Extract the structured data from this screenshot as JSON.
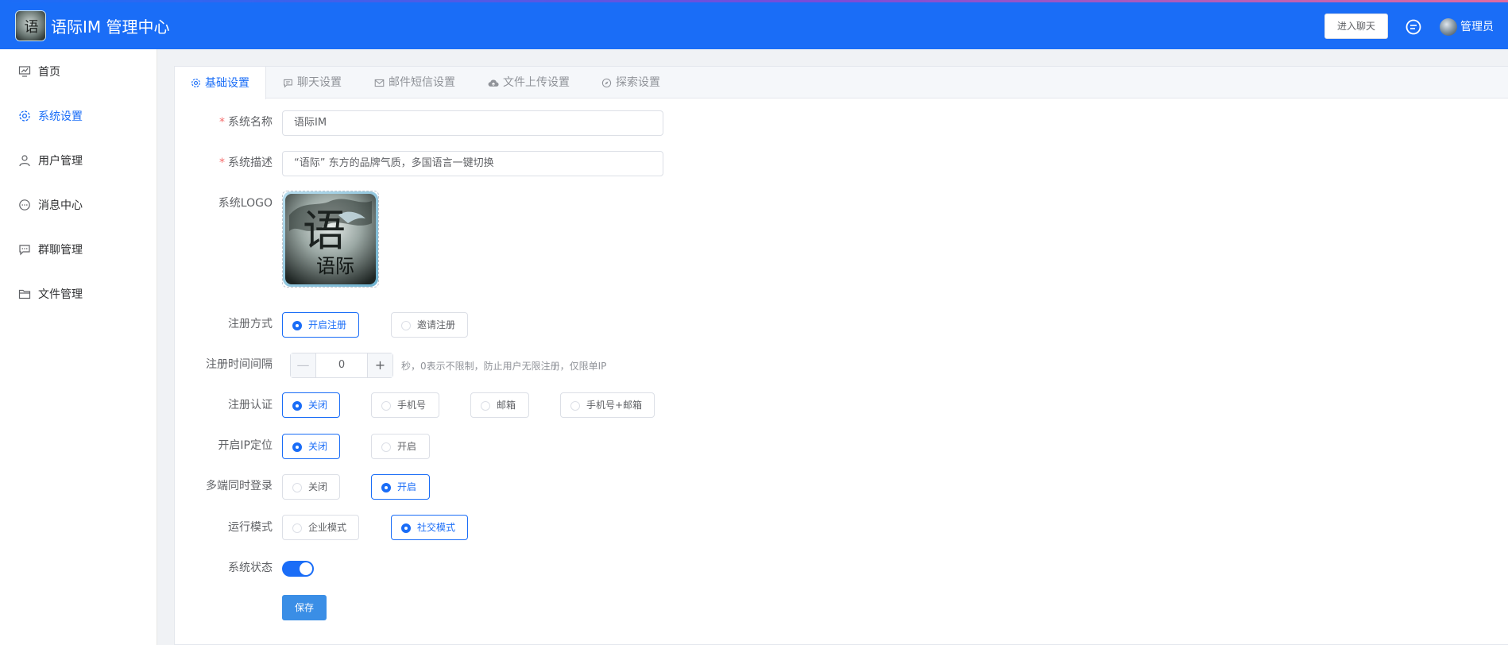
{
  "header": {
    "app_title": "语际IM 管理中心",
    "enter_chat_label": "进入聊天",
    "admin_name": "管理员",
    "brand_color": "#1a6df7"
  },
  "sidebar": {
    "items": [
      {
        "label": "首页",
        "icon": "home-chart-icon",
        "active": false
      },
      {
        "label": "系统设置",
        "icon": "gear-icon",
        "active": true
      },
      {
        "label": "用户管理",
        "icon": "user-icon",
        "active": false
      },
      {
        "label": "消息中心",
        "icon": "message-icon",
        "active": false
      },
      {
        "label": "群聊管理",
        "icon": "group-chat-icon",
        "active": false
      },
      {
        "label": "文件管理",
        "icon": "folder-icon",
        "active": false
      }
    ]
  },
  "tabs": [
    {
      "label": "基础设置",
      "icon": "gear-icon",
      "active": true
    },
    {
      "label": "聊天设置",
      "icon": "chat-icon",
      "active": false
    },
    {
      "label": "邮件短信设置",
      "icon": "mail-icon",
      "active": false
    },
    {
      "label": "文件上传设置",
      "icon": "cloud-upload-icon",
      "active": false
    },
    {
      "label": "探索设置",
      "icon": "compass-icon",
      "active": false
    }
  ],
  "form": {
    "system_name": {
      "label": "系统名称",
      "value": "语际IM",
      "required": true
    },
    "system_desc": {
      "label": "系统描述",
      "value": "“语际” 东方的品牌气质，多国语言一键切换",
      "required": true
    },
    "system_logo": {
      "label": "系统LOGO",
      "logo_text_top": "语",
      "logo_text_bottom": "语际"
    },
    "register_mode": {
      "label": "注册方式",
      "options": [
        "开启注册",
        "邀请注册"
      ],
      "selected": "开启注册"
    },
    "register_interval": {
      "label": "注册时间间隔",
      "value": "0",
      "minus": "—",
      "plus": "+",
      "hint": "秒，0表示不限制，防止用户无限注册，仅限单IP"
    },
    "register_auth": {
      "label": "注册认证",
      "options": [
        "关闭",
        "手机号",
        "邮箱",
        "手机号+邮箱"
      ],
      "selected": "关闭"
    },
    "ip_location": {
      "label": "开启IP定位",
      "options": [
        "关闭",
        "开启"
      ],
      "selected": "关闭"
    },
    "multi_login": {
      "label": "多端同时登录",
      "options": [
        "关闭",
        "开启"
      ],
      "selected": "开启"
    },
    "run_mode": {
      "label": "运行模式",
      "options": [
        "企业模式",
        "社交模式"
      ],
      "selected": "社交模式"
    },
    "system_status": {
      "label": "系统状态",
      "enabled": true
    },
    "save_label": "保存"
  }
}
